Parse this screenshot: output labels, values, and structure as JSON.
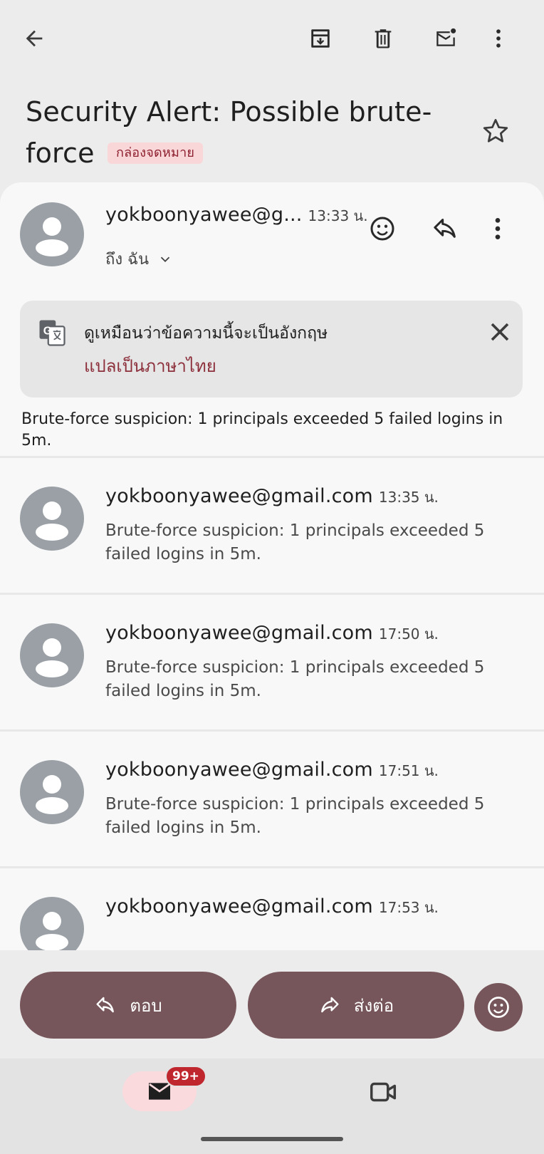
{
  "toolbar": {
    "back_icon": "arrow-back-icon",
    "archive_icon": "archive-icon",
    "delete_icon": "trash-icon",
    "mark_unread_icon": "mark-unread-icon",
    "more_icon": "more-vert-icon"
  },
  "subject": {
    "text": "Security Alert: Possible brute-force",
    "label": "กล่องจดหมาย",
    "star_icon": "star-outline-icon"
  },
  "first_message": {
    "sender": "yokboonyawee@g...",
    "time": "13:33 น.",
    "recipient": "ถึง ฉัน",
    "body": "Brute-force suspicion: 1 principals exceeded 5 failed logins in 5m."
  },
  "translate_banner": {
    "text": "ดูเหมือนว่าข้อความนี้จะเป็นอังกฤษ",
    "link": "แปลเป็นภาษาไทย"
  },
  "messages": [
    {
      "sender": "yokboonyawee@gmail.com",
      "time": "13:35 น.",
      "snippet": "Brute-force suspicion: 1 principals exceeded 5 failed logins in 5m."
    },
    {
      "sender": "yokboonyawee@gmail.com",
      "time": "17:50 น.",
      "snippet": "Brute-force suspicion: 1 principals exceeded 5 failed logins in 5m."
    },
    {
      "sender": "yokboonyawee@gmail.com",
      "time": "17:51 น.",
      "snippet": "Brute-force suspicion: 1 principals exceeded 5 failed logins in 5m."
    },
    {
      "sender": "yokboonyawee@gmail.com",
      "time": "17:53 น.",
      "snippet": ""
    }
  ],
  "actions": {
    "reply_label": "ตอบ",
    "forward_label": "ส่งต่อ"
  },
  "nav": {
    "mail_badge": "99+"
  },
  "colors": {
    "accent": "#76565a",
    "label_bg": "#f9d7d9",
    "badge": "#c0262d"
  }
}
